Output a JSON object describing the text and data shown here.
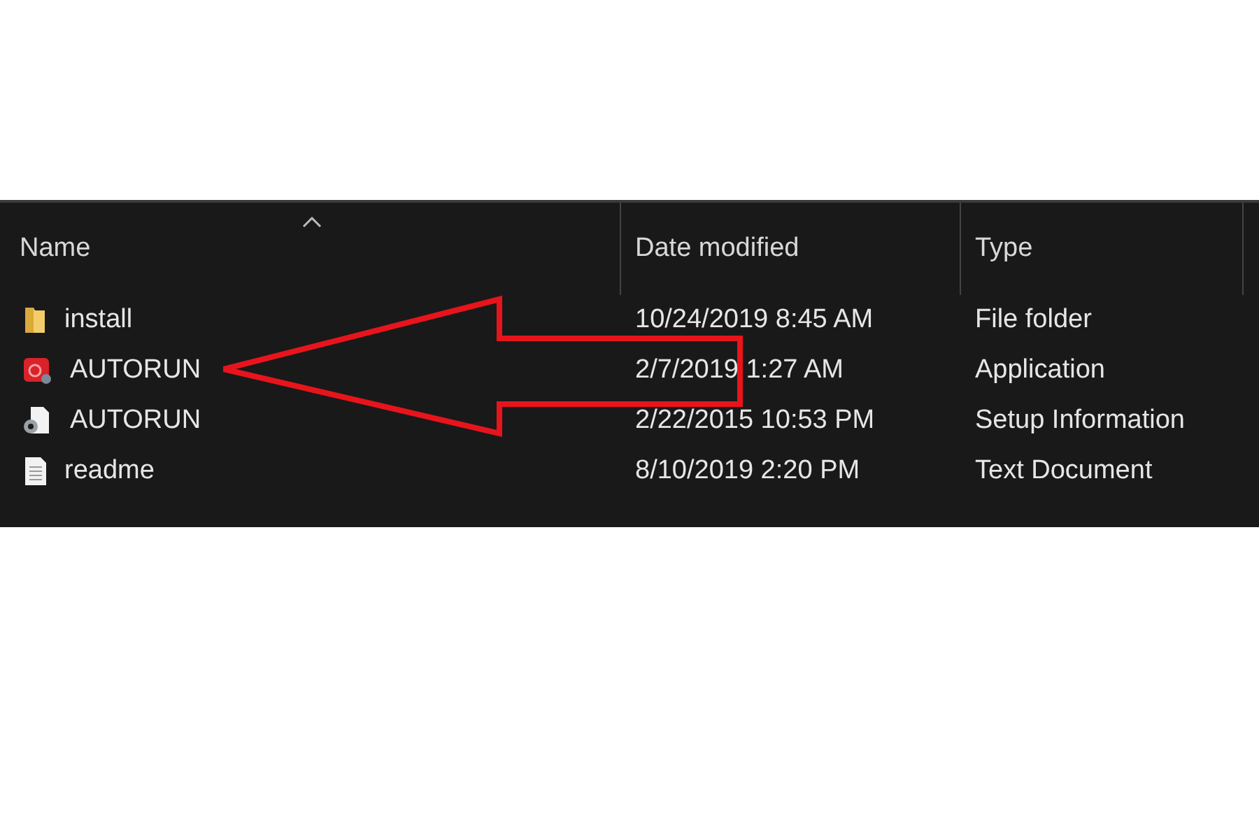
{
  "columns": [
    {
      "label": "Name",
      "sorted": true
    },
    {
      "label": "Date modified",
      "sorted": false
    },
    {
      "label": "Type",
      "sorted": false
    }
  ],
  "files": [
    {
      "name": "install",
      "date_modified": "10/24/2019 8:45 AM",
      "type": "File folder",
      "kind": "folder"
    },
    {
      "name": "AUTORUN",
      "date_modified": "2/7/2019 1:27 AM",
      "type": "Application",
      "kind": "application"
    },
    {
      "name": "AUTORUN",
      "date_modified": "2/22/2015 10:53 PM",
      "type": "Setup Information",
      "kind": "setup"
    },
    {
      "name": "readme",
      "date_modified": "8/10/2019 2:20 PM",
      "type": "Text Document",
      "kind": "text"
    }
  ]
}
